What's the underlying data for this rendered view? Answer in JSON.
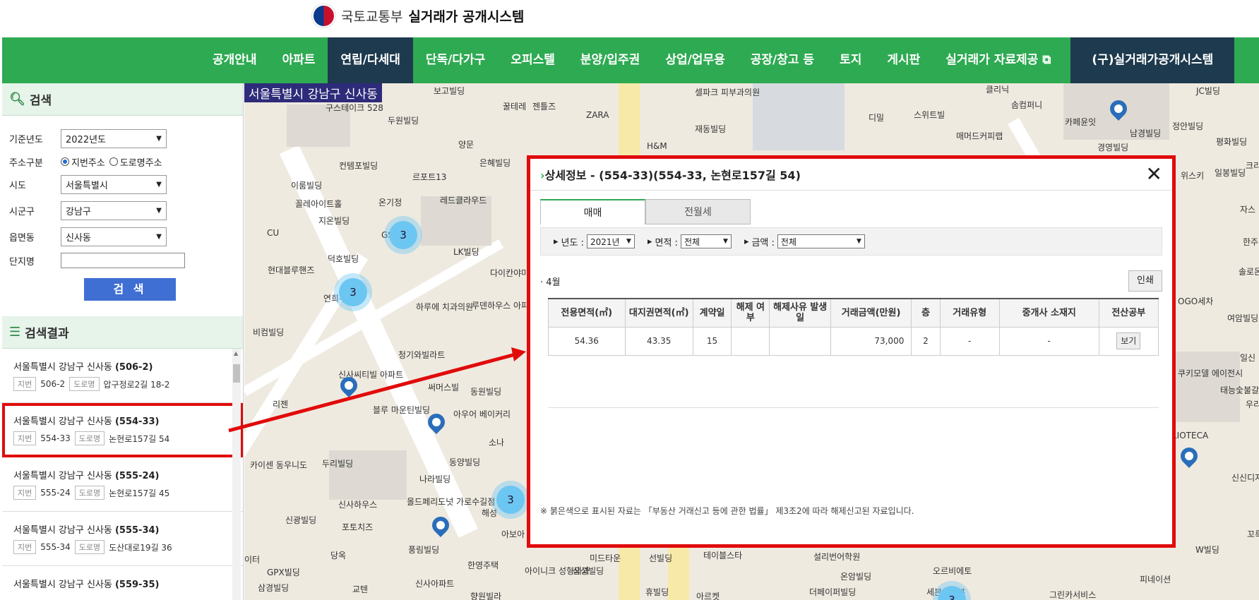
{
  "header": {
    "ministry": "국토교통부",
    "system": "실거래가 공개시스템"
  },
  "nav": {
    "items": [
      "공개안내",
      "아파트",
      "연립/다세대",
      "단독/다가구",
      "오피스텔",
      "분양/입주권",
      "상업/업무용",
      "공장/창고 등",
      "토지",
      "게시판",
      "실거래가 자료제공 ⧉"
    ],
    "last": "(구)실거래가공개시스템",
    "active_index": 2
  },
  "search": {
    "title": "검색",
    "labels": {
      "year": "기준년도",
      "addr_type": "주소구분",
      "sido": "시도",
      "sigungu": "시군구",
      "dong": "읍면동",
      "complex": "단지명"
    },
    "year": "2022년도",
    "addr_jibun": "지번주소",
    "addr_road": "도로명주소",
    "sido": "서울특별시",
    "sigungu": "강남구",
    "dong": "신사동",
    "button": "검 색"
  },
  "results": {
    "title": "검색결과",
    "tag_jibun": "지번",
    "tag_road": "도로명",
    "items": [
      {
        "area": "서울특별시 강남구 신사동",
        "code": "(506-2)",
        "jibun": "506-2",
        "road": "압구정로2길 18-2"
      },
      {
        "area": "서울특별시 강남구 신사동",
        "code": "(554-33)",
        "jibun": "554-33",
        "road": "논현로157길 54"
      },
      {
        "area": "서울특별시 강남구 신사동",
        "code": "(555-24)",
        "jibun": "555-24",
        "road": "논현로157길 45"
      },
      {
        "area": "서울특별시 강남구 신사동",
        "code": "(555-34)",
        "jibun": "555-34",
        "road": "도산대로19길 36"
      },
      {
        "area": "서울특별시 강남구 신사동",
        "code": "(559-35)",
        "jibun": "",
        "road": ""
      }
    ]
  },
  "map": {
    "region": "서울특별시 강남구 신사동",
    "labels": [
      "보고빌딩",
      "구스테이크 528",
      "두원빌딩",
      "양문",
      "컨템포빌딩",
      "르포트13",
      "은혜빌딩",
      "이룸빌딩",
      "꼴레아이트홀",
      "온기정",
      "레드클라우드",
      "지온빌딩",
      "CU",
      "덕호빌딩",
      "LK빌딩",
      "현대블루핸즈",
      "다이칸야마 키친",
      "연희우",
      "하루에 치과의원",
      "루덴하우스 아파트",
      "비컴빌딩",
      "청기와빌라트",
      "신사씨티빌 아파트",
      "써머스빌",
      "동원빌딩",
      "리젠",
      "블루 마운틴빌딩",
      "아우어 베이커리",
      "카이센 동우니도",
      "두리빌딩",
      "소나",
      "동양빌딩",
      "나라빌딩",
      "올드페리도넛 가로수길점",
      "신사하우스",
      "해성",
      "신광빌딩",
      "포토치즈",
      "당옥",
      "아보아",
      "풍림빌딩",
      "한영주택",
      "GPX빌딩",
      "이터",
      "삼경빌딩",
      "교텐",
      "신사아파트",
      "향원빌라",
      "아이니크 성형외과",
      "삼성빌딩",
      "미드타운",
      "선빌딩",
      "휴빌딩",
      "아르켓",
      "테이블스타",
      "설리번어학원",
      "온암빌딩",
      "더페이퍼빌딩",
      "오르비에토",
      "세븐일레븐",
      "그린카서비스",
      "피네이션",
      "W빌딩",
      "JC빌딩",
      "정안빌딩",
      "남경빌딩",
      "평화빌딩",
      "일봉빌딩",
      "경영빌딩",
      "카페윤잇",
      "솜컴퍼니",
      "매머드커피랩",
      "스위트빌",
      "디밀",
      "클리닉",
      "재동빌딩",
      "셀파크 피부과의원",
      "ZARA",
      "H&M",
      "꿀테레",
      "젠틀즈",
      "쿠키모델 에이전시",
      "태능숯불갈",
      "LIOTECA",
      "신신디자 현상소",
      "여암빌딩",
      "일신",
      "GS25",
      "우리",
      "솔로몬",
      "자스",
      "한주",
      "꼬륵",
      "OGO세차",
      "위스키",
      "크리"
    ],
    "clusters": [
      "3",
      "3",
      "3",
      "3"
    ]
  },
  "popup": {
    "title": "상세정보 - (554-33)(554-33, 논현로157길 54)",
    "tabs": [
      "매매",
      "전월세"
    ],
    "filters": {
      "year_label": "년도 :",
      "year": "2021년",
      "area_label": "면적 :",
      "area": "전체",
      "amount_label": "금액 :",
      "amount": "전체"
    },
    "month": "· 4월",
    "print": "인쇄",
    "columns": [
      "전용면적(㎡)",
      "대지권면적(㎡)",
      "계약일",
      "해제 여부",
      "해제사유 발생일",
      "거래금액(만원)",
      "층",
      "거래유형",
      "중개사 소재지",
      "전산공부"
    ],
    "rows": [
      {
        "area": "54.36",
        "land": "43.35",
        "day": "15",
        "cancel": "",
        "cancel_date": "",
        "price": "73,000",
        "floor": "2",
        "type": "-",
        "broker": "-",
        "doc": "보기"
      }
    ],
    "note": "※ 붉은색으로 표시된 자료는 「부동산 거래신고 등에 관한 법률」 제3조2에 따라 해제신고된 자료입니다."
  },
  "colors": {
    "nav": "#2eaa52",
    "nav_active": "#1d3a4e",
    "highlight": "#e10b0b",
    "search_button": "#3f6fd3"
  }
}
